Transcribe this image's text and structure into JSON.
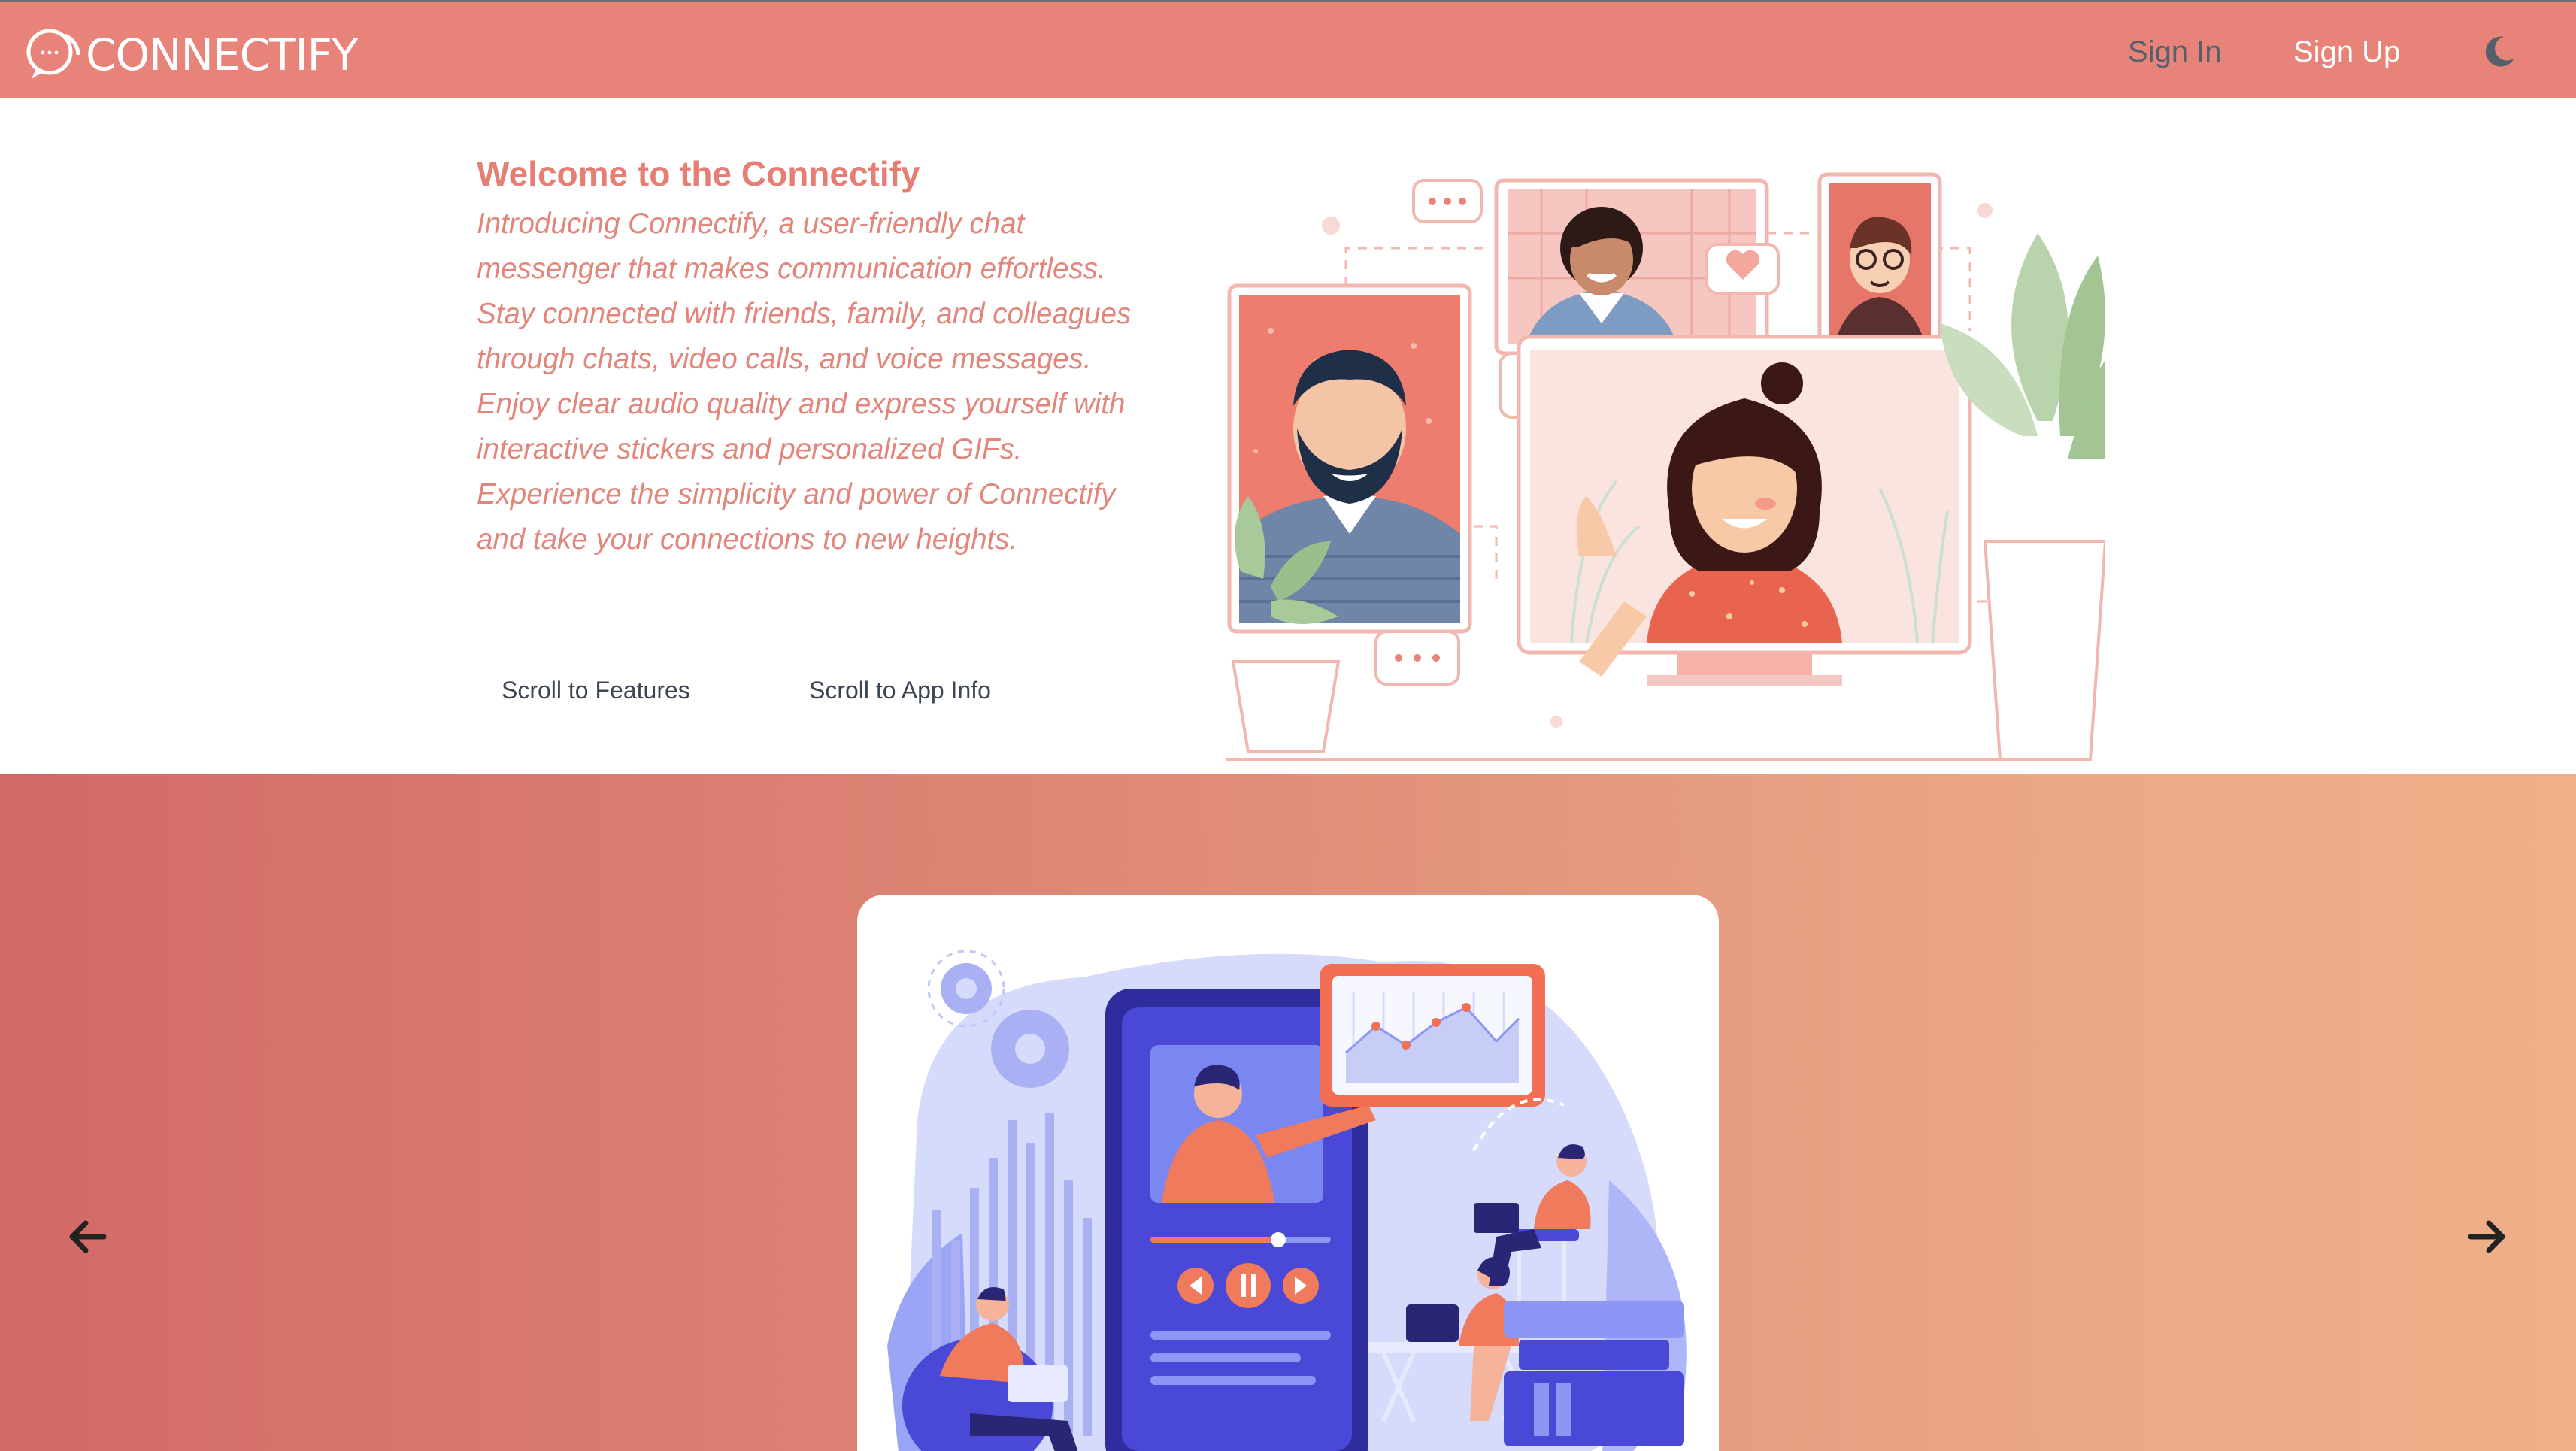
{
  "brand": {
    "name": "CONNECTIFY",
    "color": "#e8837a"
  },
  "nav": {
    "sign_in": "Sign In",
    "sign_up": "Sign Up",
    "theme_icon": "moon-icon"
  },
  "hero": {
    "title": "Welcome to the Connectify",
    "body": "Introducing Connectify, a user-friendly chat messenger that makes communication effortless. Stay connected with friends, family, and colleagues through chats, video calls, and voice messages. Enjoy clear audio quality and express yourself with interactive stickers and personalized GIFs. Experience the simplicity and power of Connectify and take your connections to new heights.",
    "buttons": {
      "features": "Scroll to Features",
      "app_info": "Scroll to App Info"
    },
    "accent": "#e57f73"
  },
  "carousel": {
    "prev_icon": "arrow-left-icon",
    "next_icon": "arrow-right-icon",
    "gradient": [
      "#d26a66",
      "#efb089"
    ]
  }
}
